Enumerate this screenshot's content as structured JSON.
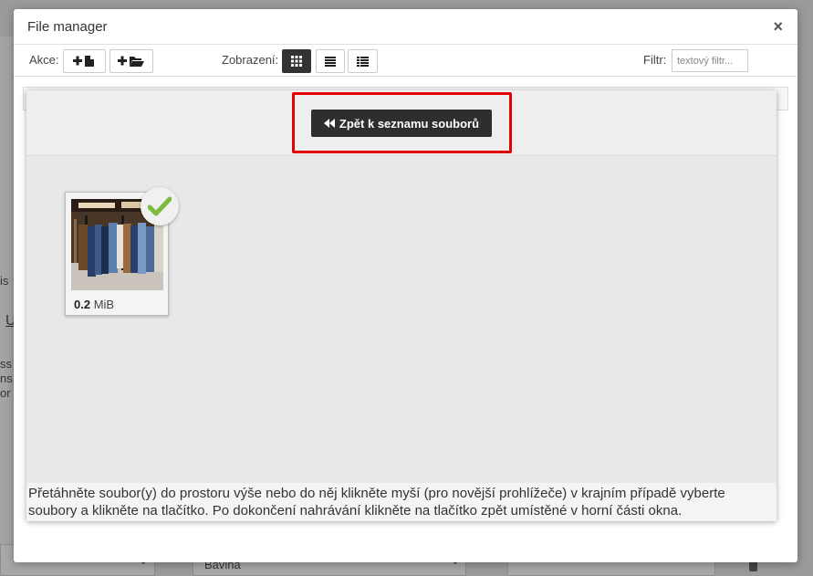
{
  "background": {
    "side_texts": [
      "is",
      "U",
      "ss",
      "ns",
      "or"
    ],
    "bottom_field_value": "Bavlna"
  },
  "modal": {
    "title": "File manager",
    "close_symbol": "×"
  },
  "toolbar": {
    "actions_label": "Akce:",
    "view_label": "Zobrazení:",
    "filter_label": "Filtr:",
    "filter_placeholder": "textový filtr...",
    "add_file_icon": "plus-file-icon",
    "add_folder_icon": "plus-folder-icon",
    "views": [
      {
        "name": "grid",
        "active": true
      },
      {
        "name": "list",
        "active": false
      },
      {
        "name": "details",
        "active": false
      }
    ]
  },
  "upload": {
    "back_button_label": "Zpět k seznamu souborů",
    "back_icon": "double-chevron-left-icon",
    "help_text": "Přetáhněte soubor(y) do prostoru výše nebo do něj klikněte myší (pro novější prohlížeče) v krajním případě vyberte soubory a klikněte na tlačítko. Po dokončení nahrávání klikněte na tlačítko zpět umístěné v horní části okna."
  },
  "files": [
    {
      "size_value": "0.2",
      "size_unit": "MiB",
      "selected": true
    }
  ],
  "colors": {
    "highlight": "#e30000",
    "check": "#7dbb3c",
    "button_dark": "#2e2e2e"
  }
}
